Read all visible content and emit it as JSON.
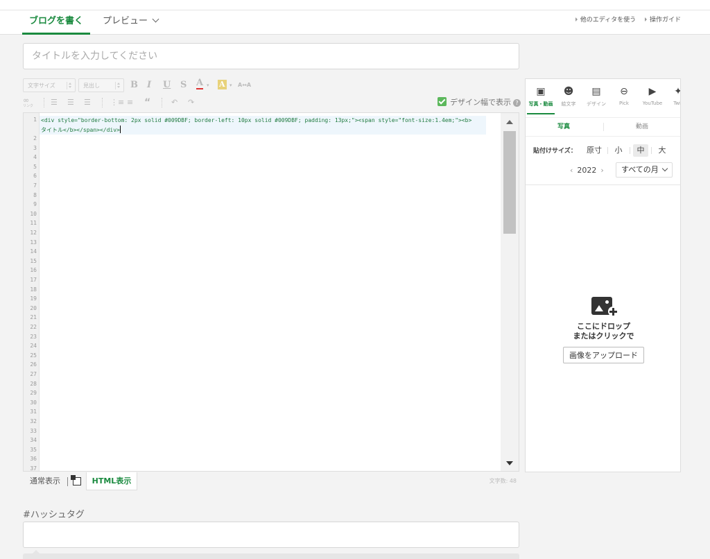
{
  "header": {
    "tab_write": "ブログを書く",
    "tab_preview": "プレビュー",
    "link_other_editor": "他のエディタを使う",
    "link_guide": "操作ガイド"
  },
  "title_input": {
    "placeholder": "タイトルを入力してください"
  },
  "toolbar": {
    "font_size": "文字サイズ",
    "heading": "見出し",
    "bold": "B",
    "italic": "I",
    "underline": "U",
    "strike": "S",
    "font_color": "A",
    "bg_color": "A",
    "link": "リンク",
    "quote": "“",
    "design_toggle": "デザイン幅で表示"
  },
  "editor": {
    "line_numbers": [
      "1",
      "2",
      "3",
      "4",
      "5",
      "6",
      "7",
      "8",
      "9",
      "10",
      "11",
      "12",
      "13",
      "14",
      "15",
      "16",
      "17",
      "18",
      "19",
      "20",
      "21",
      "22",
      "23",
      "24",
      "25",
      "26",
      "27",
      "28",
      "29",
      "30",
      "31",
      "32",
      "33",
      "34",
      "35",
      "36",
      "37"
    ],
    "code_line1": "<div style=\"border-bottom: 2px solid #009DBF; border-left: 10px solid #009DBF; padding: 13px;\"><span style=\"font-size:1.4em;\"><b>",
    "code_line1_cont": "タイトル</b></span></div>"
  },
  "modebar": {
    "normal": "通常表示",
    "html": "HTML表示",
    "char_count": "文字数: 48"
  },
  "hashtag": {
    "label": "#ハッシュタグ"
  },
  "panel": {
    "tabs": [
      {
        "icon": "photo-icon",
        "label": "写真・動画"
      },
      {
        "icon": "emoji-icon",
        "label": "絵文字"
      },
      {
        "icon": "design-icon",
        "label": "デザイン"
      },
      {
        "icon": "pick-icon",
        "label": "Pick"
      },
      {
        "icon": "youtube-icon",
        "label": "YouTube"
      },
      {
        "icon": "twitter-icon",
        "label": "Twit"
      }
    ],
    "sub_photo": "写真",
    "sub_video": "動画",
    "size_label": "貼付けサイズ：",
    "sizes": [
      "原寸",
      "小",
      "中",
      "大"
    ],
    "selected_size": "中",
    "year": "2022",
    "month_select": "すべての月",
    "drop_text_1": "ここにドロップ",
    "drop_text_2": "またはクリックで",
    "upload_button": "画像をアップロード"
  },
  "colors": {
    "accent": "#1a8a3f",
    "code_tag": "#1f7a3f"
  }
}
